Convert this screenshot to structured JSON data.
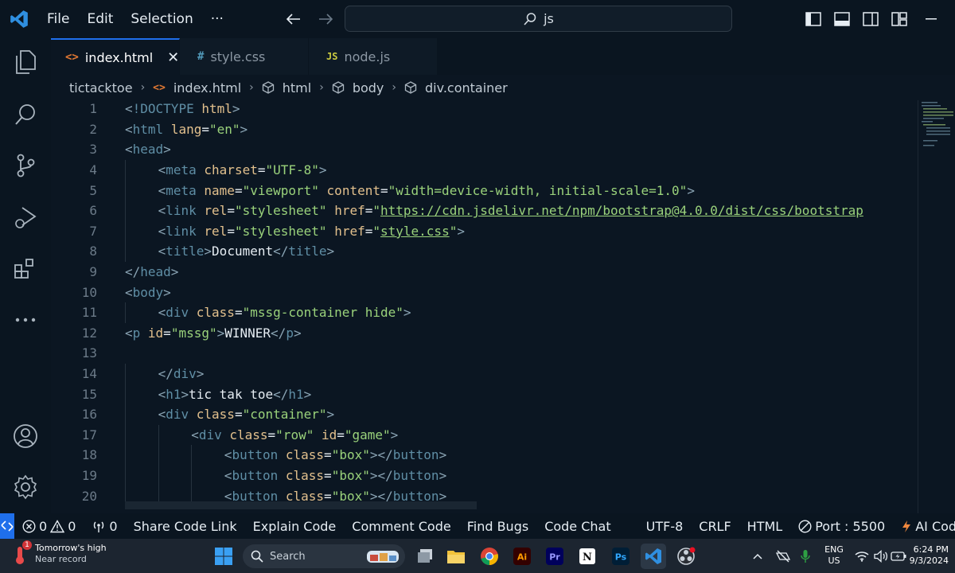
{
  "menu": {
    "file": "File",
    "edit": "Edit",
    "selection": "Selection",
    "more": "···"
  },
  "command_center": {
    "text": "js"
  },
  "tabs": [
    {
      "label": "index.html",
      "icon": "<>",
      "icon_color": "#e37933",
      "active": true
    },
    {
      "label": "style.css",
      "icon": "#",
      "icon_color": "#519aba",
      "active": false
    },
    {
      "label": "node.js",
      "icon": "JS",
      "icon_color": "#cbcb41",
      "active": false
    }
  ],
  "breadcrumb": {
    "folder": "tictacktoe",
    "file": "index.html",
    "html": "html",
    "body": "body",
    "container": "div.container"
  },
  "lines": [
    {
      "n": "1",
      "indent": 0,
      "parts": [
        [
          "brk",
          "<"
        ],
        [
          "tag",
          "!DOCTYPE "
        ],
        [
          "attr",
          "html"
        ],
        [
          "brk",
          ">"
        ]
      ]
    },
    {
      "n": "2",
      "indent": 0,
      "parts": [
        [
          "brk",
          "<"
        ],
        [
          "tag",
          "html "
        ],
        [
          "attr",
          "lang"
        ],
        [
          "txt",
          "="
        ],
        [
          "str",
          "\"en\""
        ],
        [
          "brk",
          ">"
        ]
      ]
    },
    {
      "n": "3",
      "indent": 0,
      "parts": [
        [
          "brk",
          "<"
        ],
        [
          "tag",
          "head"
        ],
        [
          "brk",
          ">"
        ]
      ]
    },
    {
      "n": "4",
      "indent": 1,
      "parts": [
        [
          "brk",
          "<"
        ],
        [
          "tag",
          "meta "
        ],
        [
          "attr",
          "charset"
        ],
        [
          "txt",
          "="
        ],
        [
          "str",
          "\"UTF-8\""
        ],
        [
          "brk",
          ">"
        ]
      ]
    },
    {
      "n": "5",
      "indent": 1,
      "parts": [
        [
          "brk",
          "<"
        ],
        [
          "tag",
          "meta "
        ],
        [
          "attr",
          "name"
        ],
        [
          "txt",
          "="
        ],
        [
          "str",
          "\"viewport\" "
        ],
        [
          "attr",
          "content"
        ],
        [
          "txt",
          "="
        ],
        [
          "str",
          "\"width=device-width, initial-scale=1.0\""
        ],
        [
          "brk",
          ">"
        ]
      ]
    },
    {
      "n": "6",
      "indent": 1,
      "parts": [
        [
          "brk",
          "<"
        ],
        [
          "tag",
          "link "
        ],
        [
          "attr",
          "rel"
        ],
        [
          "txt",
          "="
        ],
        [
          "str",
          "\"stylesheet\" "
        ],
        [
          "attr",
          "href"
        ],
        [
          "txt",
          "="
        ],
        [
          "str",
          "\""
        ],
        [
          "url",
          "https://cdn.jsdelivr.net/npm/bootstrap@4.0.0/dist/css/bootstrap"
        ]
      ]
    },
    {
      "n": "7",
      "indent": 1,
      "parts": [
        [
          "brk",
          "<"
        ],
        [
          "tag",
          "link "
        ],
        [
          "attr",
          "rel"
        ],
        [
          "txt",
          "="
        ],
        [
          "str",
          "\"stylesheet\" "
        ],
        [
          "attr",
          "href"
        ],
        [
          "txt",
          "="
        ],
        [
          "str",
          "\""
        ],
        [
          "url",
          "style.css"
        ],
        [
          "str",
          "\""
        ],
        [
          "brk",
          ">"
        ]
      ]
    },
    {
      "n": "8",
      "indent": 1,
      "parts": [
        [
          "brk",
          "<"
        ],
        [
          "tag",
          "title"
        ],
        [
          "brk",
          ">"
        ],
        [
          "txt",
          "Document"
        ],
        [
          "brk",
          "</"
        ],
        [
          "tag",
          "title"
        ],
        [
          "brk",
          ">"
        ]
      ]
    },
    {
      "n": "9",
      "indent": 0,
      "parts": [
        [
          "brk",
          "</"
        ],
        [
          "tag",
          "head"
        ],
        [
          "brk",
          ">"
        ]
      ]
    },
    {
      "n": "10",
      "indent": 0,
      "parts": [
        [
          "brk",
          "<"
        ],
        [
          "tag",
          "body"
        ],
        [
          "brk",
          ">"
        ]
      ]
    },
    {
      "n": "11",
      "indent": 1,
      "parts": [
        [
          "brk",
          "<"
        ],
        [
          "tag",
          "div "
        ],
        [
          "attr",
          "class"
        ],
        [
          "txt",
          "="
        ],
        [
          "str",
          "\"mssg-container hide\""
        ],
        [
          "brk",
          ">"
        ]
      ]
    },
    {
      "n": "12",
      "indent": 0,
      "parts": [
        [
          "brk",
          "<"
        ],
        [
          "tag",
          "p "
        ],
        [
          "attr",
          "id"
        ],
        [
          "txt",
          "="
        ],
        [
          "str",
          "\"mssg\""
        ],
        [
          "brk",
          ">"
        ],
        [
          "txt",
          "WINNER"
        ],
        [
          "brk",
          "</"
        ],
        [
          "tag",
          "p"
        ],
        [
          "brk",
          ">"
        ]
      ]
    },
    {
      "n": "13",
      "indent": 0,
      "parts": []
    },
    {
      "n": "14",
      "indent": 1,
      "parts": [
        [
          "brk",
          "</"
        ],
        [
          "tag",
          "div"
        ],
        [
          "brk",
          ">"
        ]
      ]
    },
    {
      "n": "15",
      "indent": 1,
      "parts": [
        [
          "brk",
          "<"
        ],
        [
          "tag",
          "h1"
        ],
        [
          "brk",
          ">"
        ],
        [
          "txt",
          "tic tak toe"
        ],
        [
          "brk",
          "</"
        ],
        [
          "tag",
          "h1"
        ],
        [
          "brk",
          ">"
        ]
      ]
    },
    {
      "n": "16",
      "indent": 1,
      "parts": [
        [
          "brk",
          "<"
        ],
        [
          "tag",
          "div "
        ],
        [
          "attr",
          "class"
        ],
        [
          "txt",
          "="
        ],
        [
          "str",
          "\"container\""
        ],
        [
          "brk",
          ">"
        ]
      ]
    },
    {
      "n": "17",
      "indent": 2,
      "parts": [
        [
          "brk",
          "<"
        ],
        [
          "tag",
          "div "
        ],
        [
          "attr",
          "class"
        ],
        [
          "txt",
          "="
        ],
        [
          "str",
          "\"row\" "
        ],
        [
          "attr",
          "id"
        ],
        [
          "txt",
          "="
        ],
        [
          "str",
          "\"game\""
        ],
        [
          "brk",
          ">"
        ]
      ]
    },
    {
      "n": "18",
      "indent": 3,
      "parts": [
        [
          "brk",
          "<"
        ],
        [
          "tag",
          "button "
        ],
        [
          "attr",
          "class"
        ],
        [
          "txt",
          "="
        ],
        [
          "str",
          "\"box\""
        ],
        [
          "brk",
          ">"
        ],
        [
          "brk",
          "</"
        ],
        [
          "tag",
          "button"
        ],
        [
          "brk",
          ">"
        ]
      ]
    },
    {
      "n": "19",
      "indent": 3,
      "parts": [
        [
          "brk",
          "<"
        ],
        [
          "tag",
          "button "
        ],
        [
          "attr",
          "class"
        ],
        [
          "txt",
          "="
        ],
        [
          "str",
          "\"box\""
        ],
        [
          "brk",
          ">"
        ],
        [
          "brk",
          "</"
        ],
        [
          "tag",
          "button"
        ],
        [
          "brk",
          ">"
        ]
      ]
    },
    {
      "n": "20",
      "indent": 3,
      "parts": [
        [
          "brk",
          "<"
        ],
        [
          "tag",
          "button "
        ],
        [
          "attr",
          "class"
        ],
        [
          "txt",
          "="
        ],
        [
          "str",
          "\"box\""
        ],
        [
          "brk",
          ">"
        ],
        [
          "brk",
          "</"
        ],
        [
          "tag",
          "button"
        ],
        [
          "brk",
          ">"
        ]
      ]
    }
  ],
  "status": {
    "errors": "0",
    "warnings": "0",
    "ports": "0",
    "share": "Share Code Link",
    "explain": "Explain Code",
    "comment": "Comment Code",
    "bugs": "Find Bugs",
    "chat": "Code Chat",
    "encoding": "UTF-8",
    "eol": "CRLF",
    "language": "HTML",
    "port": "Port : 5500",
    "ai": "AI Code Ch"
  },
  "taskbar": {
    "weather_title": "Tomorrow's high",
    "weather_sub": "Near record",
    "weather_badge": "1",
    "search_placeholder": "Search",
    "lang1": "ENG",
    "lang2": "US",
    "time": "6:24 PM",
    "date": "9/3/2024"
  },
  "colors": {
    "accent": "#1f6feb",
    "tag": "#5f8ea5",
    "attr": "#e2c08d",
    "string": "#9ad27b"
  }
}
